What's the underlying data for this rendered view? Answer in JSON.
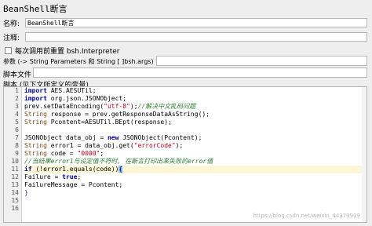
{
  "window_title": "BeanShell断言",
  "name": {
    "label": "名称:",
    "value": "BeanShell断言"
  },
  "comment": {
    "label": "注释:",
    "value": ""
  },
  "reset": {
    "label": "每次调用前重置 bsh.Interpreter",
    "checked": false
  },
  "params": {
    "label": "参数 (-> String Parameters 和 String [ ]bsh.args)",
    "value": ""
  },
  "script_file": {
    "label": "脚本文件",
    "value": ""
  },
  "script_section": {
    "label": "脚本 (见下文所定义的变量)"
  },
  "line_numbers": [
    "1",
    "2",
    "3",
    "4",
    "5",
    "6",
    "7",
    "8",
    "9",
    "10",
    "11",
    "12",
    "13",
    "14",
    "15",
    "16"
  ],
  "watermark": "https://blog.csdn.net/weixin_44379919",
  "code": [
    [
      {
        "t": "import",
        "c": "kw"
      },
      {
        "t": " AES.AESUTil;"
      }
    ],
    [
      {
        "t": "import",
        "c": "kw"
      },
      {
        "t": " org.json.JSONObject;"
      }
    ],
    [
      {
        "t": "prev.setDataEncoding("
      },
      {
        "t": "\"utf-8\"",
        "c": "str"
      },
      {
        "t": ");"
      },
      {
        "t": "//解决中文乱码问题",
        "c": "cm"
      }
    ],
    [
      {
        "t": "String",
        "c": "ty"
      },
      {
        "t": " response = prev.getResponseDataAsString();"
      }
    ],
    [
      {
        "t": "String",
        "c": "ty"
      },
      {
        "t": " Pcontent=AESUTil.BEpt(response);"
      }
    ],
    [
      {
        "t": ""
      }
    ],
    [
      {
        "t": "JSONObject data_obj = "
      },
      {
        "t": "new",
        "c": "kw"
      },
      {
        "t": " JSONObject(Pcontent);"
      }
    ],
    [
      {
        "t": "String",
        "c": "ty"
      },
      {
        "t": " error1 = data_obj.get("
      },
      {
        "t": "\"errorCode\"",
        "c": "str"
      },
      {
        "t": ");"
      }
    ],
    [
      {
        "t": "String",
        "c": "ty"
      },
      {
        "t": " code = "
      },
      {
        "t": "\"0000\"",
        "c": "str"
      },
      {
        "t": ";"
      }
    ],
    [
      {
        "t": "//当结果error1与设定值不符时, 在断言打印出来失败的error值",
        "c": "cm"
      }
    ],
    [
      {
        "t": "if",
        "c": "kw"
      },
      {
        "t": " (!error1.equals(code))"
      },
      {
        "t": "{",
        "c": "cur"
      }
    ],
    [
      {
        "t": "Failure = "
      },
      {
        "t": "true",
        "c": "kw"
      },
      {
        "t": ";"
      }
    ],
    [
      {
        "t": "FailureMessage = Pcontent;"
      }
    ],
    [
      {
        "t": "}",
        "c": "bm"
      }
    ],
    [
      {
        "t": ""
      }
    ],
    [
      {
        "t": ""
      }
    ]
  ]
}
